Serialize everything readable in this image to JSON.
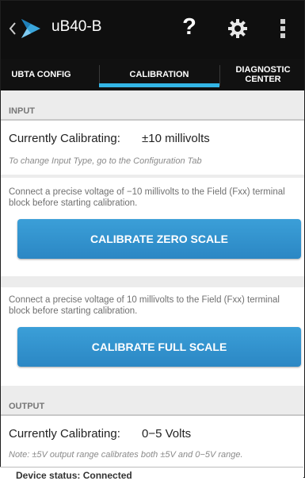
{
  "app": {
    "title": "uB40-B"
  },
  "actionbar": {
    "back_icon": "chevron-left-icon",
    "logo_icon": "app-logo-icon",
    "help_label": "?",
    "settings_icon": "gear-icon",
    "overflow_icon": "overflow-menu-icon"
  },
  "tabs": [
    {
      "label": "UBTA CONFIG"
    },
    {
      "label": "CALIBRATION",
      "selected": true
    },
    {
      "label": "DIAGNOSTIC CENTER"
    }
  ],
  "input_section": {
    "header": "INPUT",
    "calibrating_label": "Currently Calibrating:",
    "calibrating_value": "±10 millivolts",
    "hint": "To change Input Type, go to the Configuration Tab",
    "zero_instruction": "Connect a precise voltage of −10 millivolts to the Field (Fxx) terminal block before starting calibration.",
    "zero_button": "CALIBRATE ZERO SCALE",
    "full_instruction": "Connect a precise voltage of 10 millivolts to the Field (Fxx) terminal block before starting calibration.",
    "full_button": "CALIBRATE FULL SCALE"
  },
  "output_section": {
    "header": "OUTPUT",
    "calibrating_label": "Currently Calibrating:",
    "calibrating_value": "0−5 Volts",
    "note": "Note: ±5V output range calibrates both ±5V and 0−5V range."
  },
  "status": {
    "text": "Device status:  Connected"
  },
  "colors": {
    "accent": "#33b5e5",
    "button": "#2b8fcc",
    "bar": "#0f0f0f"
  }
}
